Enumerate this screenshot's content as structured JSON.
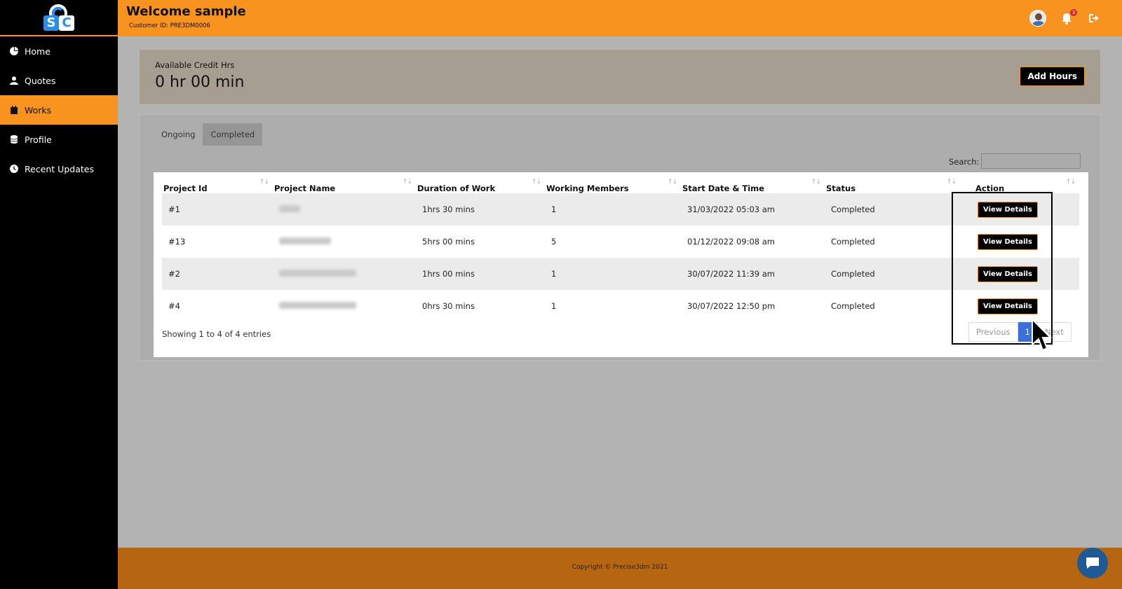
{
  "sidebar": {
    "items": [
      {
        "label": "Home",
        "icon": "pie-chart-icon"
      },
      {
        "label": "Quotes",
        "icon": "user-icon"
      },
      {
        "label": "Works",
        "icon": "calendar-icon",
        "active": true
      },
      {
        "label": "Profile",
        "icon": "database-icon"
      },
      {
        "label": "Recent Updates",
        "icon": "clock-icon"
      }
    ]
  },
  "header": {
    "title": "Welcome sample",
    "customer_id": "Customer ID: PRE3DM0006",
    "notification_count": "3"
  },
  "credit": {
    "label": "Available Credit Hrs",
    "value": "0 hr 00 min",
    "add_button": "Add Hours"
  },
  "tabs": [
    {
      "label": "Ongoing",
      "active": false
    },
    {
      "label": "Completed",
      "active": true
    }
  ],
  "search": {
    "label": "Search:",
    "value": ""
  },
  "table": {
    "columns": [
      "Project Id",
      "Project Name",
      "Duration of Work",
      "Working Members",
      "Start Date & Time",
      "Status",
      "Action"
    ],
    "rows": [
      {
        "id": "#1",
        "duration": "1hrs 30 mins",
        "members": "1",
        "start": "31/03/2022 05:03 am",
        "status": "Completed",
        "action": "View Details"
      },
      {
        "id": "#13",
        "duration": "5hrs 00 mins",
        "members": "5",
        "start": "01/12/2022 09:08 am",
        "status": "Completed",
        "action": "View Details"
      },
      {
        "id": "#2",
        "duration": "1hrs 00 mins",
        "members": "1",
        "start": "30/07/2022 11:39 am",
        "status": "Completed",
        "action": "View Details"
      },
      {
        "id": "#4",
        "duration": "0hrs 30 mins",
        "members": "1",
        "start": "30/07/2022 12:50 pm",
        "status": "Completed",
        "action": "View Details"
      }
    ],
    "showing": "Showing 1 to 4 of 4 entries",
    "pagination": {
      "previous": "Previous",
      "current": "1",
      "next": "Next"
    }
  },
  "footer": {
    "copyright": "Copyright © Precise3dm 2021"
  },
  "colors": {
    "accent": "#f7931e",
    "sidebar": "#000000",
    "footer": "#b66610",
    "chat": "#1f5a95"
  }
}
